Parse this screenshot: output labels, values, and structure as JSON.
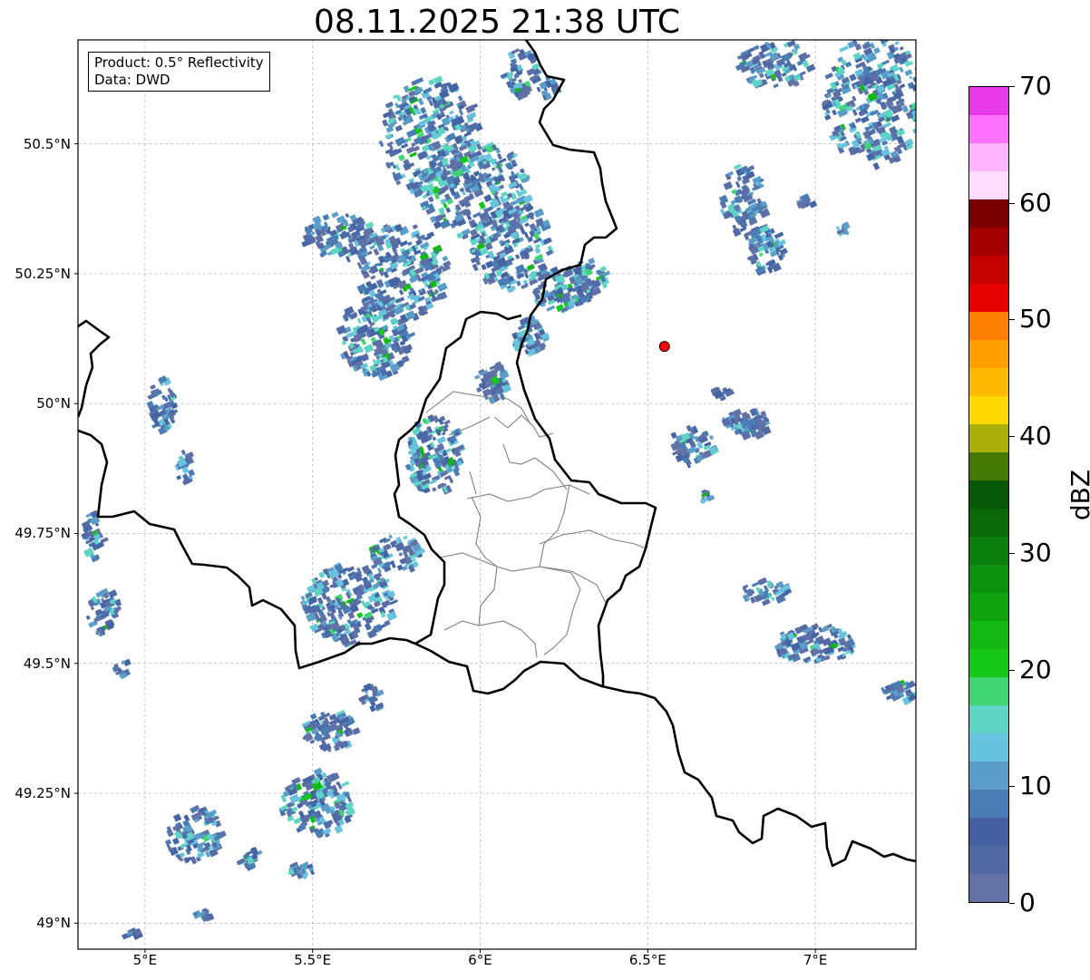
{
  "title": "08.11.2025 21:38 UTC",
  "info_box": {
    "product": "Product: 0.5° Reflectivity",
    "data": "Data: DWD"
  },
  "axes": {
    "x_ticks": [
      "5°E",
      "5.5°E",
      "6°E",
      "6.5°E",
      "7°E"
    ],
    "x_values": [
      5.0,
      5.5,
      6.0,
      6.5,
      7.0
    ],
    "y_ticks": [
      "50.5°N",
      "50.25°N",
      "50°N",
      "49.75°N",
      "49.5°N",
      "49.25°N",
      "49°N"
    ],
    "y_values": [
      50.5,
      50.25,
      50.0,
      49.75,
      49.5,
      49.25,
      49.0
    ],
    "lon_range": [
      4.8,
      7.3
    ],
    "lat_range": [
      48.95,
      50.7
    ],
    "grid": true
  },
  "radar_site": {
    "lon": 6.55,
    "lat": 50.11,
    "color": "#ff0000"
  },
  "colorbar": {
    "label": "dBZ",
    "min": 0,
    "max": 70,
    "tick_labels": [
      "0",
      "10",
      "20",
      "30",
      "40",
      "50",
      "60",
      "70"
    ],
    "tick_values": [
      0,
      10,
      20,
      30,
      40,
      50,
      60,
      70
    ],
    "colors": [
      "#6272a6",
      "#5268a2",
      "#4460a2",
      "#4a7db4",
      "#5a9dc8",
      "#66c2de",
      "#5ed5c4",
      "#3fd672",
      "#17c917",
      "#12b912",
      "#0fa40f",
      "#0d920d",
      "#0c7e0c",
      "#0a6a0a",
      "#075707",
      "#457a07",
      "#aab007",
      "#ffd800",
      "#ffb900",
      "#ff9f00",
      "#ff8000",
      "#e60000",
      "#c40000",
      "#a50000",
      "#7a0000",
      "#ffdcff",
      "#ffb4ff",
      "#ff70ff",
      "#e83ae8"
    ]
  },
  "colors": {
    "border_thick": "#000000",
    "border_thin": "#808080",
    "grid": "#b0b0b0"
  }
}
